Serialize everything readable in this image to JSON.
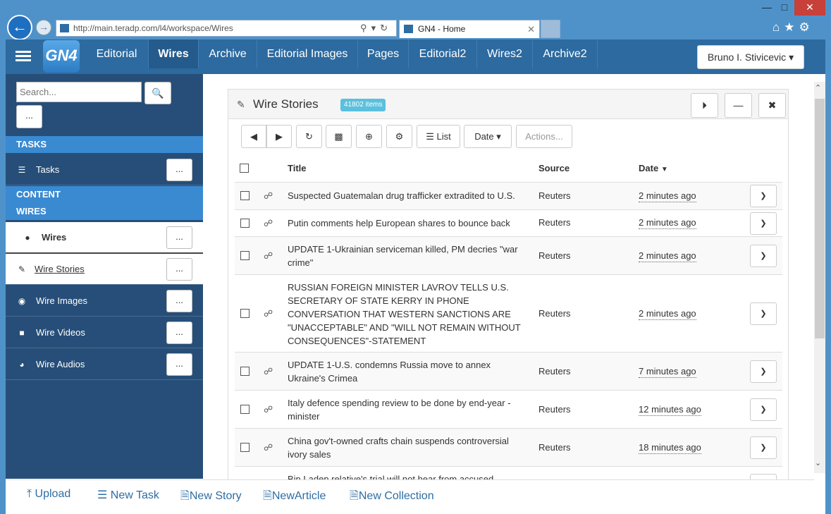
{
  "browser": {
    "url": "http://main.teradp.com/l4/workspace/Wires",
    "tab_title": "GN4 - Home",
    "window_controls": [
      "minimize",
      "maximize",
      "close"
    ]
  },
  "app": {
    "logo": "GN4",
    "nav": [
      {
        "label": "Editorial",
        "active": false
      },
      {
        "label": "Wires",
        "active": true
      },
      {
        "label": "Archive",
        "active": false
      },
      {
        "label": "Editorial Images",
        "active": false
      },
      {
        "label": "Pages",
        "active": false
      },
      {
        "label": "Editorial2",
        "active": false
      },
      {
        "label": "Wires2",
        "active": false
      },
      {
        "label": "Archive2",
        "active": false
      }
    ],
    "user": "Bruno I. Stivicevic"
  },
  "sidebar": {
    "search_placeholder": "Search...",
    "menu_button": "...",
    "tasks_header": "TASKS",
    "tasks_item": "Tasks",
    "content_header": "CONTENT",
    "wires_header": "WIRES",
    "items": [
      {
        "label": "Wires",
        "icon": "globe-icon"
      },
      {
        "label": "Wire Stories",
        "icon": "pencil-icon"
      },
      {
        "label": "Wire Images",
        "icon": "camera-icon"
      },
      {
        "label": "Wire Videos",
        "icon": "video-icon"
      },
      {
        "label": "Wire Audios",
        "icon": "headphones-icon"
      }
    ],
    "dots": "..."
  },
  "panel": {
    "title": "Wire Stories",
    "badge": "41802 items",
    "toolbar": {
      "list": "List",
      "date": "Date",
      "actions": "Actions..."
    },
    "columns": {
      "title": "Title",
      "source": "Source",
      "date": "Date"
    },
    "rows": [
      {
        "title": "Suspected Guatemalan drug trafficker extradited to U.S.",
        "source": "Reuters",
        "date": "2 minutes ago"
      },
      {
        "title": "Putin comments help European shares to bounce back",
        "source": "Reuters",
        "date": "2 minutes ago"
      },
      {
        "title": "UPDATE 1-Ukrainian serviceman killed, PM decries \"war crime\"",
        "source": "Reuters",
        "date": "2 minutes ago"
      },
      {
        "title": "RUSSIAN FOREIGN MINISTER LAVROV TELLS U.S. SECRETARY OF STATE KERRY IN PHONE CONVERSATION THAT WESTERN SANCTIONS ARE \"UNACCEPTABLE\" AND \"WILL NOT REMAIN WITHOUT CONSEQUENCES\"-STATEMENT",
        "source": "Reuters",
        "date": "2 minutes ago"
      },
      {
        "title": "UPDATE 1-U.S. condemns Russia move to annex Ukraine's Crimea",
        "source": "Reuters",
        "date": "7 minutes ago"
      },
      {
        "title": "Italy defence spending review to be done by end-year - minister",
        "source": "Reuters",
        "date": "12 minutes ago"
      },
      {
        "title": "China gov't-owned crafts chain suspends controversial ivory sales",
        "source": "Reuters",
        "date": "18 minutes ago"
      },
      {
        "title": "Bin Laden relative's trial will not hear from accused",
        "source": "",
        "date": ""
      }
    ]
  },
  "bottom": {
    "upload": "Upload",
    "new_task": "New Task",
    "new_story": "New Story",
    "new_article": "NewArticle",
    "new_collection": "New Collection"
  }
}
